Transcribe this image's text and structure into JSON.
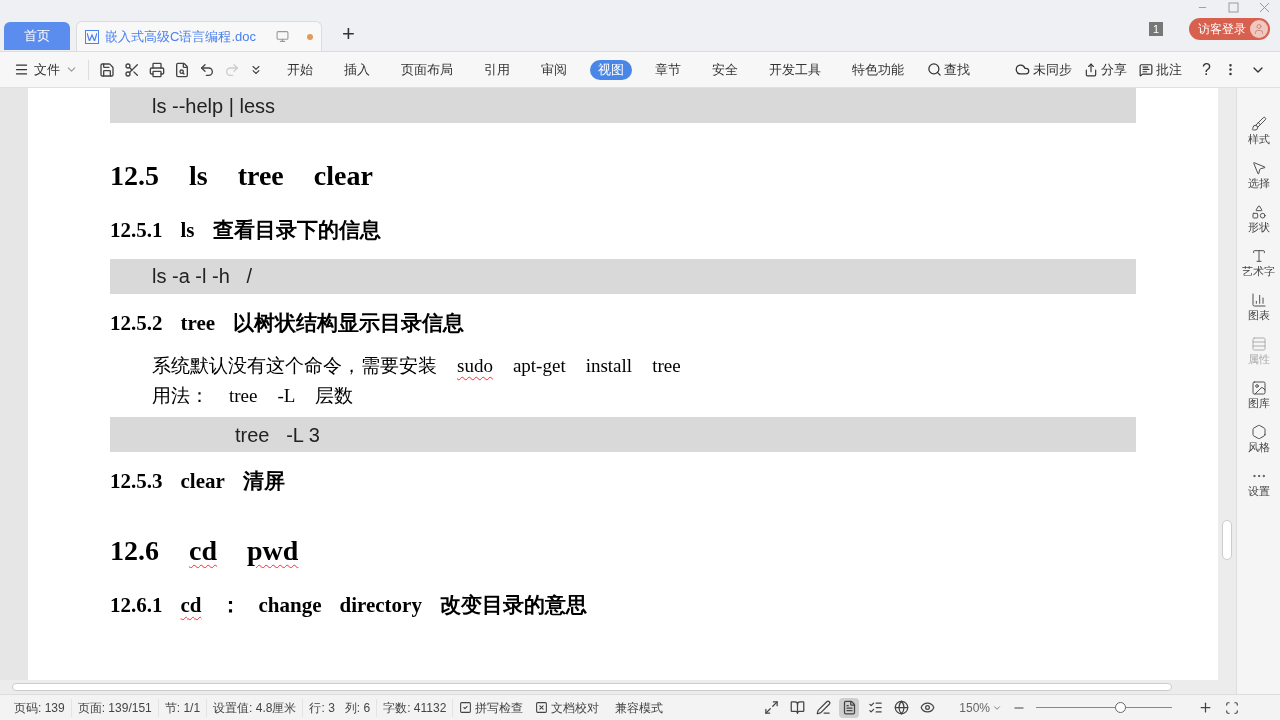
{
  "tabs": [
    {
      "label": "首页",
      "kind": "home",
      "selected": false
    },
    {
      "label": "嵌入式高级C语言编程.doc",
      "kind": "doc",
      "selected": true
    }
  ],
  "new_tab": "+",
  "window_count": "1",
  "login": "访客登录",
  "toolbar": {
    "file": "文件",
    "ribbon_tabs": [
      {
        "label": "开始",
        "selected": false
      },
      {
        "label": "插入",
        "selected": false
      },
      {
        "label": "页面布局",
        "selected": false
      },
      {
        "label": "引用",
        "selected": false
      },
      {
        "label": "审阅",
        "selected": false
      },
      {
        "label": "视图",
        "selected": true
      },
      {
        "label": "章节",
        "selected": false
      },
      {
        "label": "安全",
        "selected": false
      },
      {
        "label": "开发工具",
        "selected": false
      },
      {
        "label": "特色功能",
        "selected": false
      }
    ],
    "find": "查找",
    "sync": "未同步",
    "share": "分享",
    "comment": "批注",
    "help": "?"
  },
  "document": [
    {
      "kind": "code",
      "indent": false,
      "text": "ls --help | less"
    },
    {
      "kind": "h2",
      "parts": [
        {
          "text": "12.5",
          "wavy": false
        },
        {
          "text": "ls",
          "wavy": false
        },
        {
          "text": "tree",
          "wavy": false
        },
        {
          "text": "clear",
          "wavy": false
        }
      ]
    },
    {
      "kind": "h3",
      "parts": [
        {
          "text": "12.5.1",
          "wavy": false
        },
        {
          "text": "ls",
          "wavy": false
        },
        {
          "text": "查看目录下的信息",
          "wavy": false
        }
      ]
    },
    {
      "kind": "code",
      "indent": false,
      "text": "ls -a -l -h   /"
    },
    {
      "kind": "h3",
      "parts": [
        {
          "text": "12.5.2",
          "wavy": false
        },
        {
          "text": "tree",
          "wavy": false
        },
        {
          "text": "以树状结构显示目录信息",
          "wavy": false
        }
      ]
    },
    {
      "kind": "para",
      "parts": [
        {
          "text": "系统默认没有这个命令，需要安装",
          "wavy": false
        },
        {
          "text": "sudo",
          "wavy": true
        },
        {
          "text": "apt-get",
          "wavy": false
        },
        {
          "text": "install",
          "wavy": false
        },
        {
          "text": "tree",
          "wavy": false
        }
      ]
    },
    {
      "kind": "para",
      "parts": [
        {
          "text": "用法：",
          "wavy": false
        },
        {
          "text": "tree",
          "wavy": false
        },
        {
          "text": "-L",
          "wavy": false
        },
        {
          "text": "层数",
          "wavy": false
        }
      ]
    },
    {
      "kind": "code",
      "indent": true,
      "text": "tree   -L 3"
    },
    {
      "kind": "h3",
      "parts": [
        {
          "text": "12.5.3",
          "wavy": false
        },
        {
          "text": "clear",
          "wavy": false
        },
        {
          "text": "清屏",
          "wavy": false
        }
      ]
    },
    {
      "kind": "h2",
      "parts": [
        {
          "text": "12.6",
          "wavy": false
        },
        {
          "text": "cd",
          "wavy": true
        },
        {
          "text": "pwd",
          "wavy": true
        }
      ]
    },
    {
      "kind": "h3",
      "parts": [
        {
          "text": "12.6.1",
          "wavy": false
        },
        {
          "text": "cd",
          "wavy": true
        },
        {
          "text": "：",
          "wavy": false
        },
        {
          "text": "change",
          "wavy": false
        },
        {
          "text": "directory",
          "wavy": false
        },
        {
          "text": "改变目录的意思",
          "wavy": false
        }
      ]
    }
  ],
  "sidebar": [
    {
      "label": "样式",
      "kind": "pen",
      "disabled": false
    },
    {
      "label": "选择",
      "kind": "cursor",
      "disabled": false
    },
    {
      "label": "形状",
      "kind": "shapes",
      "disabled": false
    },
    {
      "label": "艺术字",
      "kind": "art",
      "disabled": false
    },
    {
      "label": "图表",
      "kind": "chart",
      "disabled": false
    },
    {
      "label": "属性",
      "kind": "props",
      "disabled": true
    },
    {
      "label": "图库",
      "kind": "image",
      "disabled": false
    },
    {
      "label": "风格",
      "kind": "style",
      "disabled": false
    },
    {
      "label": "设置",
      "kind": "more",
      "disabled": false
    }
  ],
  "status_bar": {
    "items": [
      {
        "text": "页码: 139"
      },
      {
        "text": "页面: 139/151"
      },
      {
        "text": "节: 1/1"
      },
      {
        "text": "设置值: 4.8厘米"
      },
      {
        "text": "行: 3   列: 6"
      },
      {
        "text": "字数: 41132"
      }
    ],
    "spell_check": "拼写检查",
    "doc_check": "文档校对",
    "compat": "兼容模式",
    "view_modes": [
      {
        "kind": "fullscreen",
        "selected": false
      },
      {
        "kind": "read",
        "selected": false
      },
      {
        "kind": "edit",
        "selected": false
      },
      {
        "kind": "page",
        "selected": true
      },
      {
        "kind": "outline",
        "selected": false
      },
      {
        "kind": "web",
        "selected": false
      },
      {
        "kind": "eye",
        "selected": false
      }
    ],
    "zoom": "150%",
    "zoom_slider": {
      "level": 0.62
    }
  }
}
